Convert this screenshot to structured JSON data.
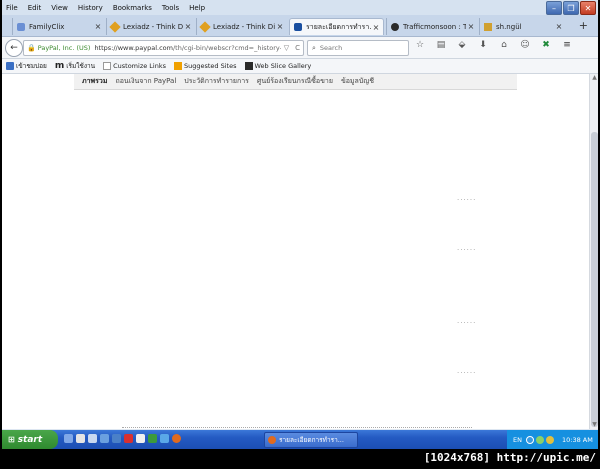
{
  "menu": [
    "File",
    "Edit",
    "View",
    "History",
    "Bookmarks",
    "Tools",
    "Help"
  ],
  "window_controls": {
    "minimize": "–",
    "restore": "❐",
    "close": "✕"
  },
  "tabs": [
    {
      "label": "FamilyClix",
      "color": "#6a8fd4",
      "active": false
    },
    {
      "label": "Lexiadz - Think Diff...",
      "color": "#e0a020",
      "active": false
    },
    {
      "label": "Lexiadz - Think Diff...",
      "color": "#e0a020",
      "active": false
    },
    {
      "label": "รายละเอียดการทำรา...",
      "color": "#1a4fa0",
      "active": true
    },
    {
      "label": "Trafficmonsoon : T...",
      "color": "#2a2a2a",
      "active": false
    },
    {
      "label": "sh.ngül",
      "color": "#d0a030",
      "active": false
    }
  ],
  "tab_close": "×",
  "new_tab": "+",
  "navbar": {
    "back": "←",
    "lock": "🔒",
    "org": "PayPal, Inc. (US)",
    "url_host": "https://www.paypal.com",
    "url_path": "/th/cgi-bin/webscr?cmd=_history-detail",
    "reload": "C",
    "dropdown": "▽",
    "search_placeholder": "Search",
    "search_icon": "⌕",
    "toolbar_icons": [
      "☆",
      "▤",
      "⬙",
      "⬇",
      "⌂",
      "☺",
      "✖",
      "≡"
    ]
  },
  "bookmarks": [
    {
      "label": "เข้าชมบ่อย",
      "icon": "bookmark-icon",
      "color": "#3a6fc4"
    },
    {
      "label": "เริ่มใช้งาน",
      "icon": "m-icon",
      "color": "#111"
    },
    {
      "label": "Customize Links",
      "icon": "page-icon",
      "color": "#fff"
    },
    {
      "label": "Suggested Sites",
      "icon": "bing-icon",
      "color": "#f0a000"
    },
    {
      "label": "Web Slice Gallery",
      "icon": "slice-icon",
      "color": "#2a2a2a"
    }
  ],
  "subnav": [
    "ภาพรวม",
    "ถอนเงินจาก PayPal",
    "ประวัติการทำรายการ",
    "ศูนย์ร้องเรียนกรณีซื้อขาย",
    "ข้อมูลบัญชี"
  ],
  "ellipses": [
    "......",
    "......",
    "......",
    "......"
  ],
  "taskbar": {
    "start": "start",
    "task_label": "รายละเอียดการทำรา...",
    "lang": "EN",
    "clock": "10:38 AM"
  },
  "watermark": "[1024x768] http://upic.me/"
}
